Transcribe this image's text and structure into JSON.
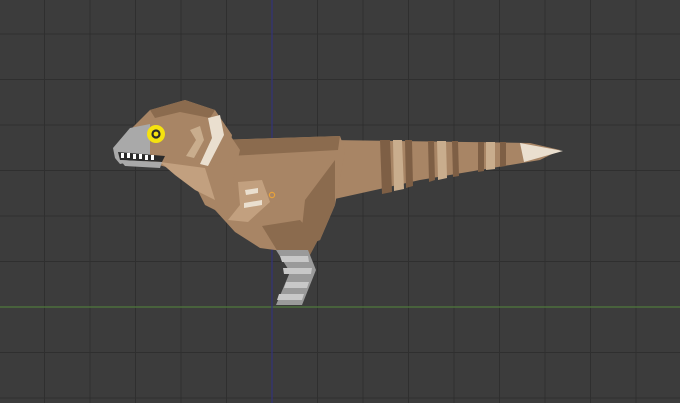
{
  "viewport": {
    "background_color": "#3c3c3c",
    "grid_color": "#2f2f2f",
    "grid_minor_color": "#363636",
    "x_axis_color": "#4f7a3c",
    "z_axis_color": "#33337a"
  },
  "model": {
    "icon": "dinosaur-model-icon",
    "origin_color": "#e8a23a",
    "colors": {
      "body": "#a88565",
      "body_dark": "#8b6b4e",
      "body_light": "#c9ad8d",
      "stripe_dark": "#7e5f45",
      "belly": "#c2a07f",
      "cream": "#eadfcf",
      "snout_gray": "#a9a9a9",
      "teeth_white": "#ffffff",
      "mouth_dark": "#2b2b2b",
      "eye_yellow": "#f5e20f",
      "leg_gray": "#9a9a9a",
      "leg_light": "#c8c8c8"
    }
  }
}
